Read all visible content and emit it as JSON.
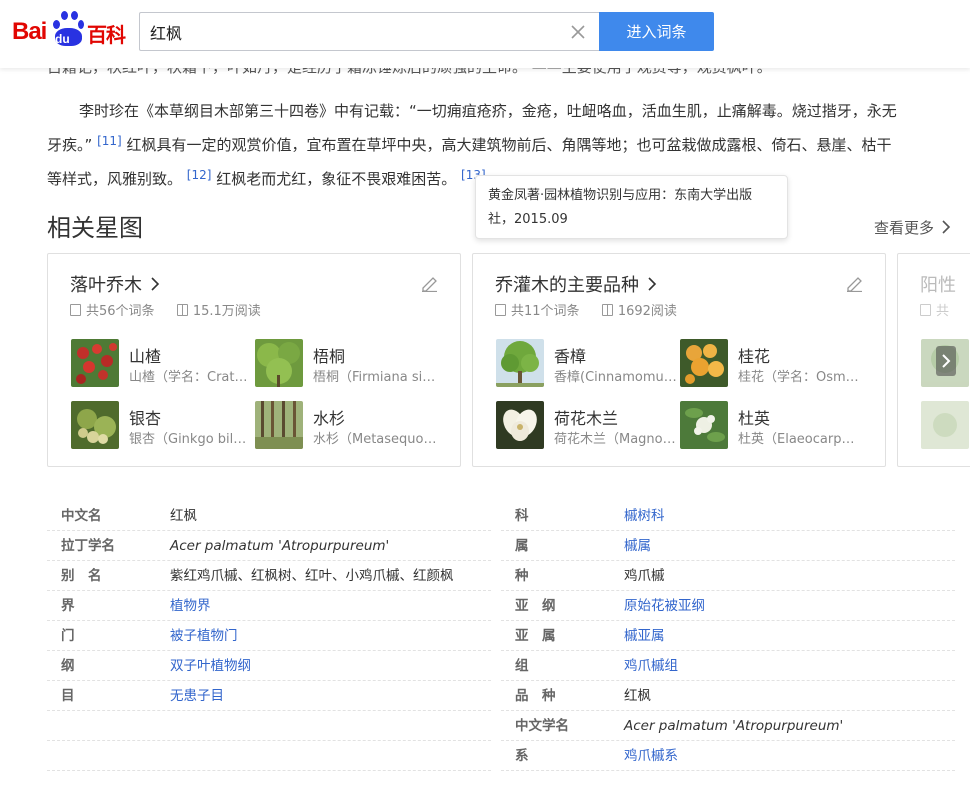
{
  "header": {
    "logo_text_bai": "Bai",
    "logo_text_du": "du",
    "logo_text_baike": "百科",
    "search_value": "红枫",
    "enter_button_label": "进入词条",
    "brand_color": "#e10602",
    "button_color": "#3f89ec"
  },
  "content": {
    "top_line": "古籍记，秋红叶，秋霜下，叶如丹，是经历了霜冻锤炼后的顽强的生命。  ——主要使用于观赏等，观赏枫叶。",
    "para_line1": "李时珍在《本草纲目木部第三十四卷》中有记载：“一切痈疽疮疥，金疮，吐衄咯血，活血生肌，止痛解毒。烧过揩牙，永无",
    "para_line2_a": "牙疾。”",
    "ref_11": "[11]",
    "para_line2_b": "红枫具有一定的观赏价值，宜布置在草坪中央，高大建筑物前后、角隅等地；也可盆栽做成露根、倚石、悬崖、枯干",
    "para_line3_a": "等样式，风雅别致。",
    "ref_12": "[12]",
    "para_line3_b": "红枫老而尤红，象征不畏艰难困苦。",
    "ref_13": "[13]",
    "tooltip_text": "黄金凤著·园林植物识别与应用：东南大学出版社，2015.09"
  },
  "related": {
    "title": "相关星图",
    "see_more": "查看更多",
    "cards": [
      {
        "title": "落叶乔木",
        "count": "共56个词条",
        "reads": "15.1万阅读",
        "items": [
          {
            "name": "山楂",
            "desc": "山楂（学名：Crataegus pinnatifida）"
          },
          {
            "name": "梧桐",
            "desc": "梧桐（Firmiana simplex）"
          },
          {
            "name": "银杏",
            "desc": "银杏（Ginkgo biloba）"
          },
          {
            "name": "水杉",
            "desc": "水杉（Metasequoia）"
          }
        ]
      },
      {
        "title": "乔灌木的主要品种",
        "count": "共11个词条",
        "reads": "1692阅读",
        "items": [
          {
            "name": "香樟",
            "desc": "香樟(Cinnamomum camphora)"
          },
          {
            "name": "桂花",
            "desc": "桂花（学名：Osmanthus）"
          },
          {
            "name": "荷花木兰",
            "desc": "荷花木兰（Magnolia）"
          },
          {
            "name": "杜英",
            "desc": "杜英（Elaeocarpus）"
          }
        ]
      },
      {
        "title": "阳性",
        "count": "共",
        "reads": "",
        "items": []
      }
    ]
  },
  "info": {
    "left": [
      {
        "key": "中文名",
        "value": "红枫",
        "link": false,
        "italic": false
      },
      {
        "key": "拉丁学名",
        "value": "Acer palmatum 'Atropurpureum'",
        "link": false,
        "italic": true
      },
      {
        "key": "别　名",
        "value": "紫红鸡爪槭、红枫树、红叶、小鸡爪槭、红颜枫",
        "link": false,
        "italic": false
      },
      {
        "key": "界",
        "value": "植物界",
        "link": true,
        "italic": false
      },
      {
        "key": "门",
        "value": "被子植物门",
        "link": true,
        "italic": false
      },
      {
        "key": "纲",
        "value": "双子叶植物纲",
        "link": true,
        "italic": false
      },
      {
        "key": "目",
        "value": "无患子目",
        "link": true,
        "italic": false
      }
    ],
    "right": [
      {
        "key": "科",
        "value": "槭树科",
        "link": true,
        "italic": false
      },
      {
        "key": "属",
        "value": "槭属",
        "link": true,
        "italic": false
      },
      {
        "key": "种",
        "value": "鸡爪槭",
        "link": false,
        "italic": false
      },
      {
        "key": "亚　纲",
        "value": "原始花被亚纲",
        "link": true,
        "italic": false
      },
      {
        "key": "亚　属",
        "value": "槭亚属",
        "link": true,
        "italic": false
      },
      {
        "key": "组",
        "value": "鸡爪槭组",
        "link": true,
        "italic": false
      },
      {
        "key": "品　种",
        "value": "红枫",
        "link": false,
        "italic": false
      },
      {
        "key": "中文学名",
        "value": "Acer palmatum 'Atropurpureum'",
        "link": false,
        "italic": true
      },
      {
        "key": "系",
        "value": "鸡爪槭系",
        "link": true,
        "italic": false
      }
    ]
  }
}
